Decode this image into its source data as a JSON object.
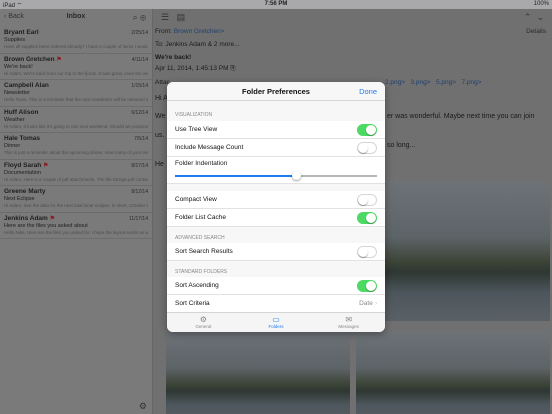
{
  "status": {
    "carrier": "iPad ⌔",
    "time": "7:56 PM",
    "battery": "100%"
  },
  "inbox": {
    "back": "Back",
    "title": "Inbox",
    "messages": [
      {
        "from": "Bryant Earl",
        "date": "2/25/14",
        "subject": "Supplies",
        "preview": "Have all supplies been ordered already? I have a couple of items I would like to add to the list if that's possible. If not, please",
        "flag": false
      },
      {
        "from": "Brown Gretchen",
        "date": "4/11/14",
        "subject": "We're back!",
        "preview": "Hi Adam, We're back from our trip to the fjords. It was great, even the weather was wonderful. Maybe next time you can join us.",
        "flag": true
      },
      {
        "from": "Campbell Alan",
        "date": "1/15/14",
        "subject": "Newsletter",
        "preview": "Hello Team, This is a reminder that the next newsletter will be released in a month. Please have your articles ready in time.",
        "flag": false
      },
      {
        "from": "Huff Alison",
        "date": "6/12/14",
        "subject": "Weather",
        "preview": "Hi Adam, It looks like it's going to rain next weekend. Should we postpone? Best, Alison",
        "flag": false
      },
      {
        "from": "Hale Tomas",
        "date": "7/5/14",
        "subject": "Dinner",
        "preview": "This is just a reminder about the upcoming dinner. How many of your team are coming? Cheers, Tomas",
        "flag": false
      },
      {
        "from": "Floyd Sarah",
        "date": "8/17/14",
        "subject": "Documentation",
        "preview": "Hi Adam, Here is a couple of pdf attachments. The file Strings.pdf contains a description on how to use strings in Cocoa, while the o",
        "flag": true
      },
      {
        "from": "Greene Marty",
        "date": "8/12/14",
        "subject": "Next Eclipse",
        "preview": "Hi Adam, See the data for the next total lunar eclipse. In short, October 8th, 2014. It will be visible from North America, Australia",
        "flag": false
      },
      {
        "from": "Jenkins Adam",
        "date": "11/17/14",
        "subject": "Here are the files you asked about",
        "preview": "Hello Nike, Here are the files you asked for. I hope the layout works as well, it's really nice. Let me know if there is anything",
        "flag": true
      }
    ]
  },
  "message": {
    "from_label": "From:",
    "from": "Brown Gretchen",
    "to": "To: Jenkins Adam",
    "more": "& 2 more...",
    "details": "Details",
    "subject": "We're back!",
    "date": "Apr 11, 2014, 1:45:13 PM",
    "attach_label": "Attac",
    "attachments": [
      ".png>",
      "2.png>",
      "3.png>",
      "5.png>",
      "7.png>"
    ],
    "greeting": "Hi A",
    "line1_start": "We",
    "line1_end": "er was wonderful. Maybe next time you can join",
    "line2_start": "us.",
    "line2_end": "so long...",
    "line3_start": "He"
  },
  "modal": {
    "title": "Folder Preferences",
    "done": "Done",
    "sections": {
      "visualization": "VISUALIZATION",
      "advanced": "ADVANCED SEARCH",
      "standard": "STANDARD FOLDERS"
    },
    "rows": {
      "tree_view": "Use Tree View",
      "message_count": "Include Message Count",
      "indentation": "Folder Indentation",
      "compact_view": "Compact View",
      "list_cache": "Folder List Cache",
      "sort_results": "Sort Search Results",
      "sort_ascending": "Sort Ascending",
      "sort_criteria": "Sort Criteria",
      "sort_criteria_value": "Date"
    },
    "toggles": {
      "tree_view": true,
      "message_count": false,
      "compact_view": false,
      "list_cache": true,
      "sort_results": false,
      "sort_ascending": true
    },
    "indentation_level": 0.6,
    "tabs": [
      {
        "label": "General",
        "icon": "gear-icon"
      },
      {
        "label": "Folders",
        "icon": "folder-icon"
      },
      {
        "label": "Messages",
        "icon": "envelope-icon"
      }
    ],
    "active_tab": "Folders",
    "accent_color": "#1c7cf2",
    "toggle_on_color": "#4cd964"
  }
}
